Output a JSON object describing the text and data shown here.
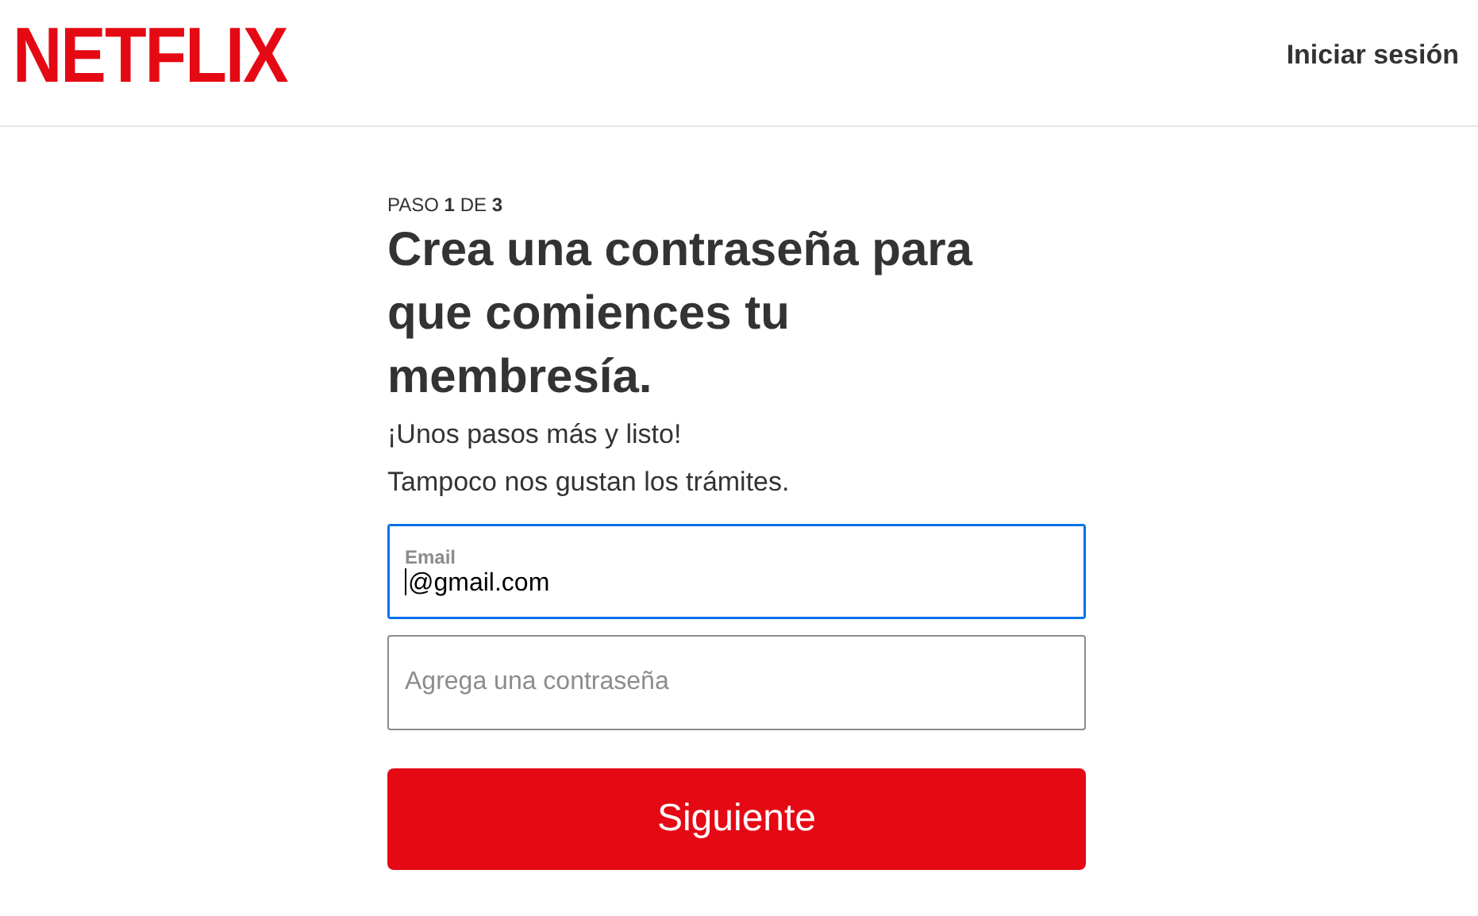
{
  "header": {
    "logo": "NETFLIX",
    "sign_in": "Iniciar sesión"
  },
  "step": "PASO **1** DE **3**",
  "title": "Crea una contraseña para que comiences tu membresía.",
  "lines": [
    "¡Unos pasos más y listo!",
    "Tampoco nos gustan los trámites."
  ],
  "fields": [
    {
      "label": "Email",
      "value": "@gmail.com",
      "focused": true
    },
    {
      "placeholder": "Agrega una contraseña",
      "focused": false
    }
  ],
  "button": "Siguiente"
}
